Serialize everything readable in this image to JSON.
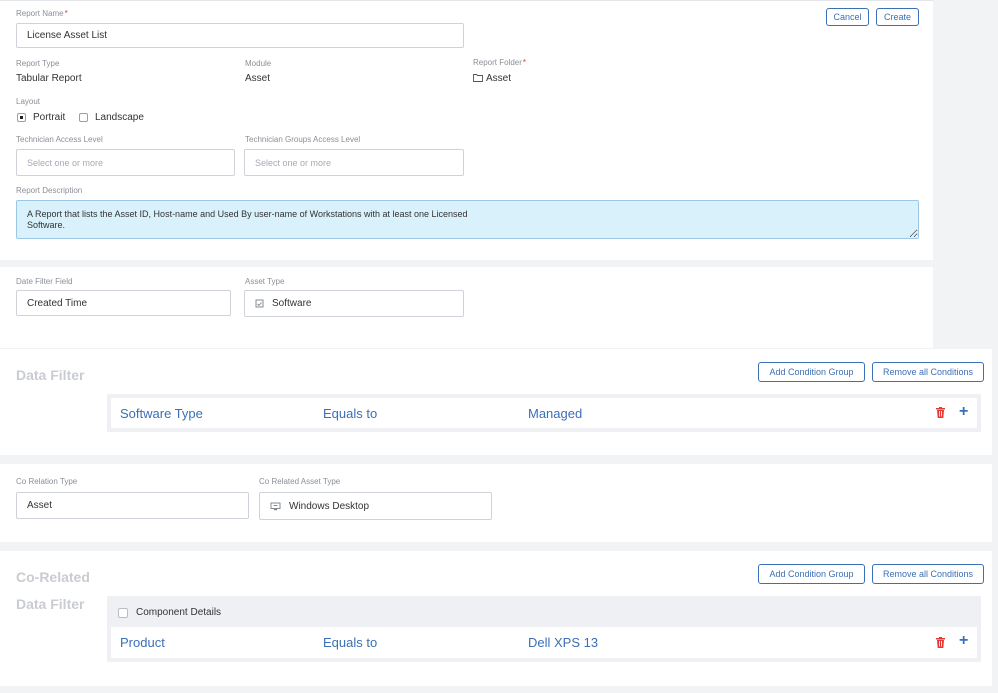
{
  "report": {
    "name_label": "Report Name",
    "name_value": "License Asset List",
    "cancel": "Cancel",
    "create": "Create",
    "type_label": "Report Type",
    "type_value": "Tabular Report",
    "module_label": "Module",
    "module_value": "Asset",
    "folder_label": "Report Folder",
    "folder_value": "Asset",
    "layout_label": "Layout",
    "layout_portrait": "Portrait",
    "layout_landscape": "Landscape",
    "tech_access_label": "Technician Access Level",
    "tech_access_placeholder": "Select one or more",
    "tech_groups_label": "Technician Groups Access Level",
    "tech_groups_placeholder": "Select one or more",
    "desc_label": "Report Description",
    "desc_value": "A Report that lists the Asset ID, Host-name and Used By user-name of Workstations with at least one Licensed\nSoftware."
  },
  "filter_fields": {
    "date_label": "Date Filter Field",
    "date_value": "Created Time",
    "asset_type_label": "Asset Type",
    "asset_type_value": "Software"
  },
  "data_filter": {
    "title": "Data Filter",
    "add_group": "Add Condition Group",
    "remove_all": "Remove all Conditions",
    "condition": {
      "field": "Software Type",
      "operator": "Equals to",
      "value": "Managed"
    }
  },
  "corelation": {
    "type_label": "Co Relation Type",
    "type_value": "Asset",
    "asset_type_label": "Co Related Asset Type",
    "asset_type_value": "Windows Desktop"
  },
  "corelated_filter": {
    "title_line1": "Co-Related",
    "title_line2": "Data Filter",
    "add_group": "Add Condition Group",
    "remove_all": "Remove all Conditions",
    "component_details": "Component Details",
    "condition": {
      "field": "Product",
      "operator": "Equals to",
      "value": "Dell XPS 13"
    }
  },
  "colors": {
    "accent": "#3b6fb6",
    "danger": "#e53935",
    "highlight": "#d9f1fb"
  }
}
